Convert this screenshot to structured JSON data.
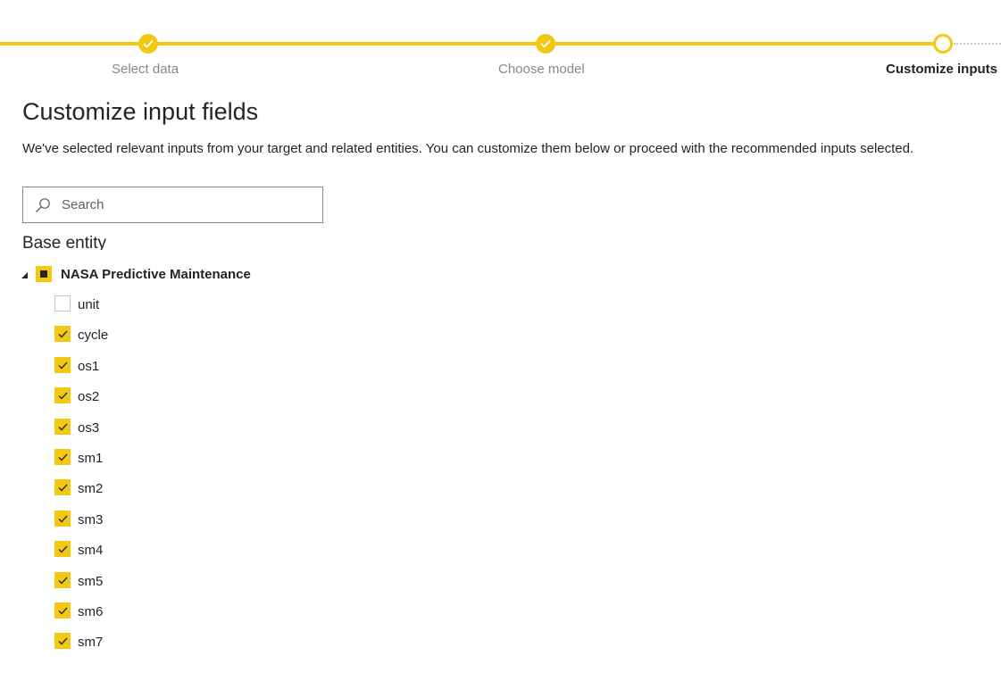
{
  "stepper": {
    "steps": [
      {
        "label": "Select data",
        "state": "done"
      },
      {
        "label": "Choose model",
        "state": "done"
      },
      {
        "label": "Customize inputs",
        "state": "current"
      }
    ]
  },
  "header": {
    "title": "Customize input fields",
    "description": "We've selected relevant inputs from your target and related entities. You can customize them below or proceed with the recommended inputs selected."
  },
  "search": {
    "placeholder": "Search",
    "value": ""
  },
  "tree": {
    "section_heading": "Base entity",
    "entity": {
      "label": "NASA Predictive Maintenance",
      "expanded": true,
      "check_state": "partial",
      "fields": [
        {
          "label": "unit",
          "checked": false
        },
        {
          "label": "cycle",
          "checked": true
        },
        {
          "label": "os1",
          "checked": true
        },
        {
          "label": "os2",
          "checked": true
        },
        {
          "label": "os3",
          "checked": true
        },
        {
          "label": "sm1",
          "checked": true
        },
        {
          "label": "sm2",
          "checked": true
        },
        {
          "label": "sm3",
          "checked": true
        },
        {
          "label": "sm4",
          "checked": true
        },
        {
          "label": "sm5",
          "checked": true
        },
        {
          "label": "sm6",
          "checked": true
        },
        {
          "label": "sm7",
          "checked": true
        }
      ]
    }
  },
  "colors": {
    "accent": "#f2c811",
    "text": "#252423",
    "muted_text": "#8a8886",
    "border": "#8a8886"
  },
  "icons": {
    "step_done": "checkmark-icon",
    "search": "search-icon",
    "tree_toggle": "expand-caret-icon"
  }
}
